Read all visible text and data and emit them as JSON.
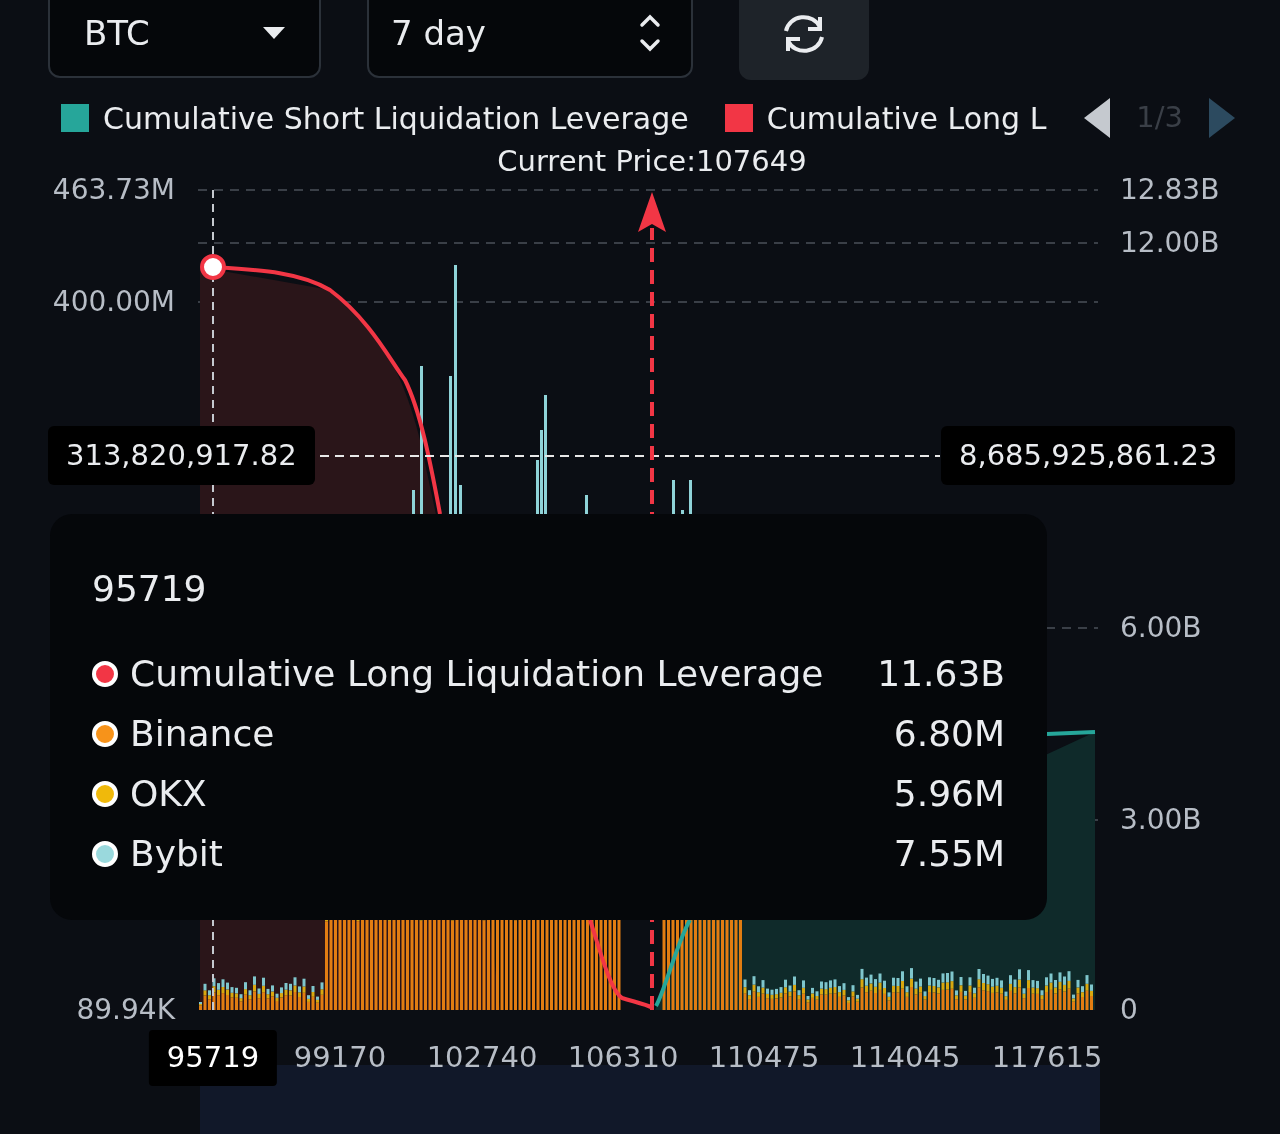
{
  "controls": {
    "symbol": "BTC",
    "range": "7 day"
  },
  "legend": {
    "items": [
      {
        "label": "Cumulative Short Liquidation Leverage",
        "color": "#26a69a"
      },
      {
        "label": "Cumulative Long L",
        "color": "#f23645"
      }
    ],
    "page": "1/3"
  },
  "current_price": "Current Price:107649",
  "left_axis": [
    "463.73M",
    "400.00M",
    "89.94K"
  ],
  "right_axis": [
    "12.83B",
    "12.00B",
    "6.00B",
    "3.00B",
    "0"
  ],
  "crosshair": {
    "left_value": "313,820,917.82",
    "right_value": "8,685,925,861.23"
  },
  "tooltip": {
    "title": "95719",
    "rows": [
      {
        "name": "Cumulative Long Liquidation Leverage",
        "value": "11.63B",
        "color": "#f23645"
      },
      {
        "name": "Binance",
        "value": "6.80M",
        "color": "#f7931a"
      },
      {
        "name": "OKX",
        "value": "5.96M",
        "color": "#f0b90b"
      },
      {
        "name": "Bybit",
        "value": "7.55M",
        "color": "#9ad9dd"
      }
    ]
  },
  "x_axis": [
    {
      "label": "95719",
      "selected": true
    },
    {
      "label": "99170",
      "selected": false
    },
    {
      "label": "102740",
      "selected": false
    },
    {
      "label": "106310",
      "selected": false
    },
    {
      "label": "110475",
      "selected": false
    },
    {
      "label": "114045",
      "selected": false
    },
    {
      "label": "117615",
      "selected": false
    }
  ]
}
